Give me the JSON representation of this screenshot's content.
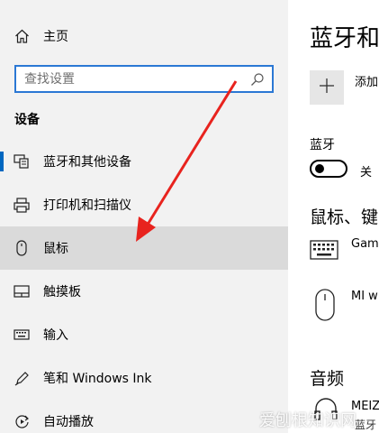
{
  "sidebar": {
    "home_label": "主页",
    "search_placeholder": "查找设置",
    "section_title": "设备",
    "items": [
      {
        "label": "蓝牙和其他设备",
        "icon": "bluetooth-devices-icon"
      },
      {
        "label": "打印机和扫描仪",
        "icon": "printer-icon"
      },
      {
        "label": "鼠标",
        "icon": "mouse-icon"
      },
      {
        "label": "触摸板",
        "icon": "touchpad-icon"
      },
      {
        "label": "输入",
        "icon": "keyboard-icon"
      },
      {
        "label": "笔和 Windows Ink",
        "icon": "pen-icon"
      },
      {
        "label": "自动播放",
        "icon": "autoplay-icon"
      }
    ],
    "active_index": 0,
    "selected_index": 2
  },
  "content": {
    "title": "蓝牙和",
    "add_label": "添加",
    "bluetooth_label": "蓝牙",
    "toggle_state": "关",
    "section_mouse_keyboard": "鼠标、键",
    "devices": [
      {
        "name": "Gam",
        "icon": "keyboard-icon"
      },
      {
        "name": "MI w",
        "icon": "mouse-icon"
      }
    ],
    "section_audio": "音频",
    "audio_device": "MEIZ",
    "audio_sub": "蓝牙"
  },
  "watermark": "爱刨根知识网",
  "colors": {
    "accent": "#0067c0",
    "search_border": "#2b78d4",
    "arrow": "#e8231e",
    "sidebar_bg": "#f2f2f2",
    "selected_bg": "#dadada"
  }
}
